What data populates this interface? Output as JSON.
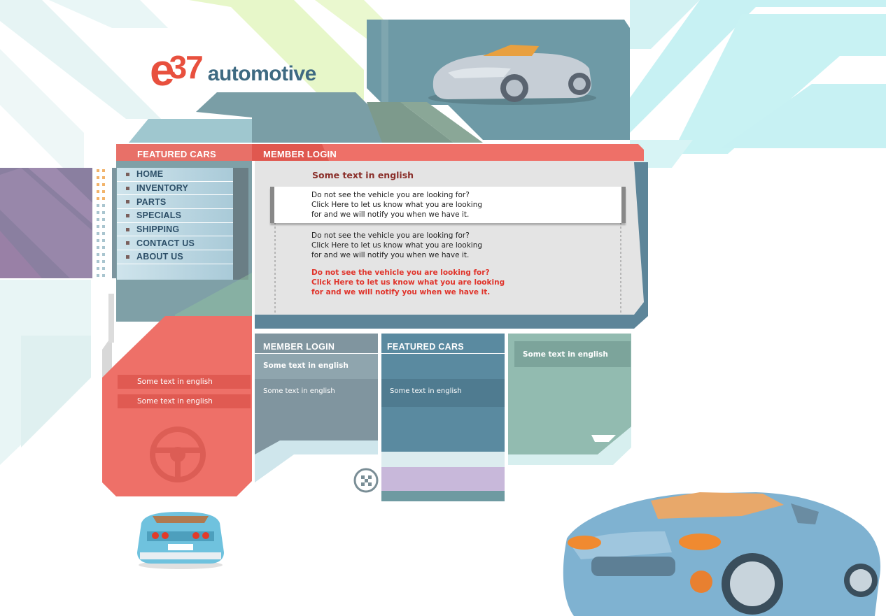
{
  "brand": {
    "logo_letter": "e",
    "logo_number": "37",
    "logo_word": "automotive",
    "colors": {
      "red": "#ee7068",
      "teal": "#5a8aa0",
      "slate": "#6f8f9d",
      "mint": "#92bbb0",
      "grey": "#e4e4e4"
    }
  },
  "left_panel": {
    "header": "FEATURED CARS",
    "nav": [
      {
        "label": "HOME"
      },
      {
        "label": "INVENTORY"
      },
      {
        "label": "PARTS"
      },
      {
        "label": "SPECIALS"
      },
      {
        "label": "SHIPPING"
      },
      {
        "label": "CONTACT US"
      },
      {
        "label": "ABOUT US"
      }
    ],
    "red_links": [
      "Some text in english",
      "Some text in english"
    ],
    "icon": "steering-wheel-icon"
  },
  "member_login": {
    "header": "MEMBER LOGIN",
    "title": "Some text in english",
    "box_lines": [
      "Do not see the vehicle you are looking for?",
      "Click Here to let us know what you are looking",
      "for and we will notify you when we have it."
    ],
    "para_lines": [
      "Do not see the vehicle you are looking for?",
      "Click Here to let us know what you are looking",
      "for and we will notify you when we have it."
    ],
    "red_lines": [
      "Do not see the vehicle you are looking for?",
      "Click Here to let us know what you are looking",
      "for and we will notify you when we have it."
    ]
  },
  "bottom": {
    "col1": {
      "header": "MEMBER LOGIN",
      "bold": "Some text in english",
      "text": "Some text in english"
    },
    "col2": {
      "header": "FEATURED CARS",
      "text": "Some text in english"
    },
    "col3": {
      "bold": "Some text in english"
    }
  },
  "images": {
    "top_car": "silver-roadster-image",
    "bottom_left_car": "blue-sportscar-rear-image",
    "bottom_right_car": "blue-coupe-image",
    "round_icon": "checkered-flag-icon"
  }
}
